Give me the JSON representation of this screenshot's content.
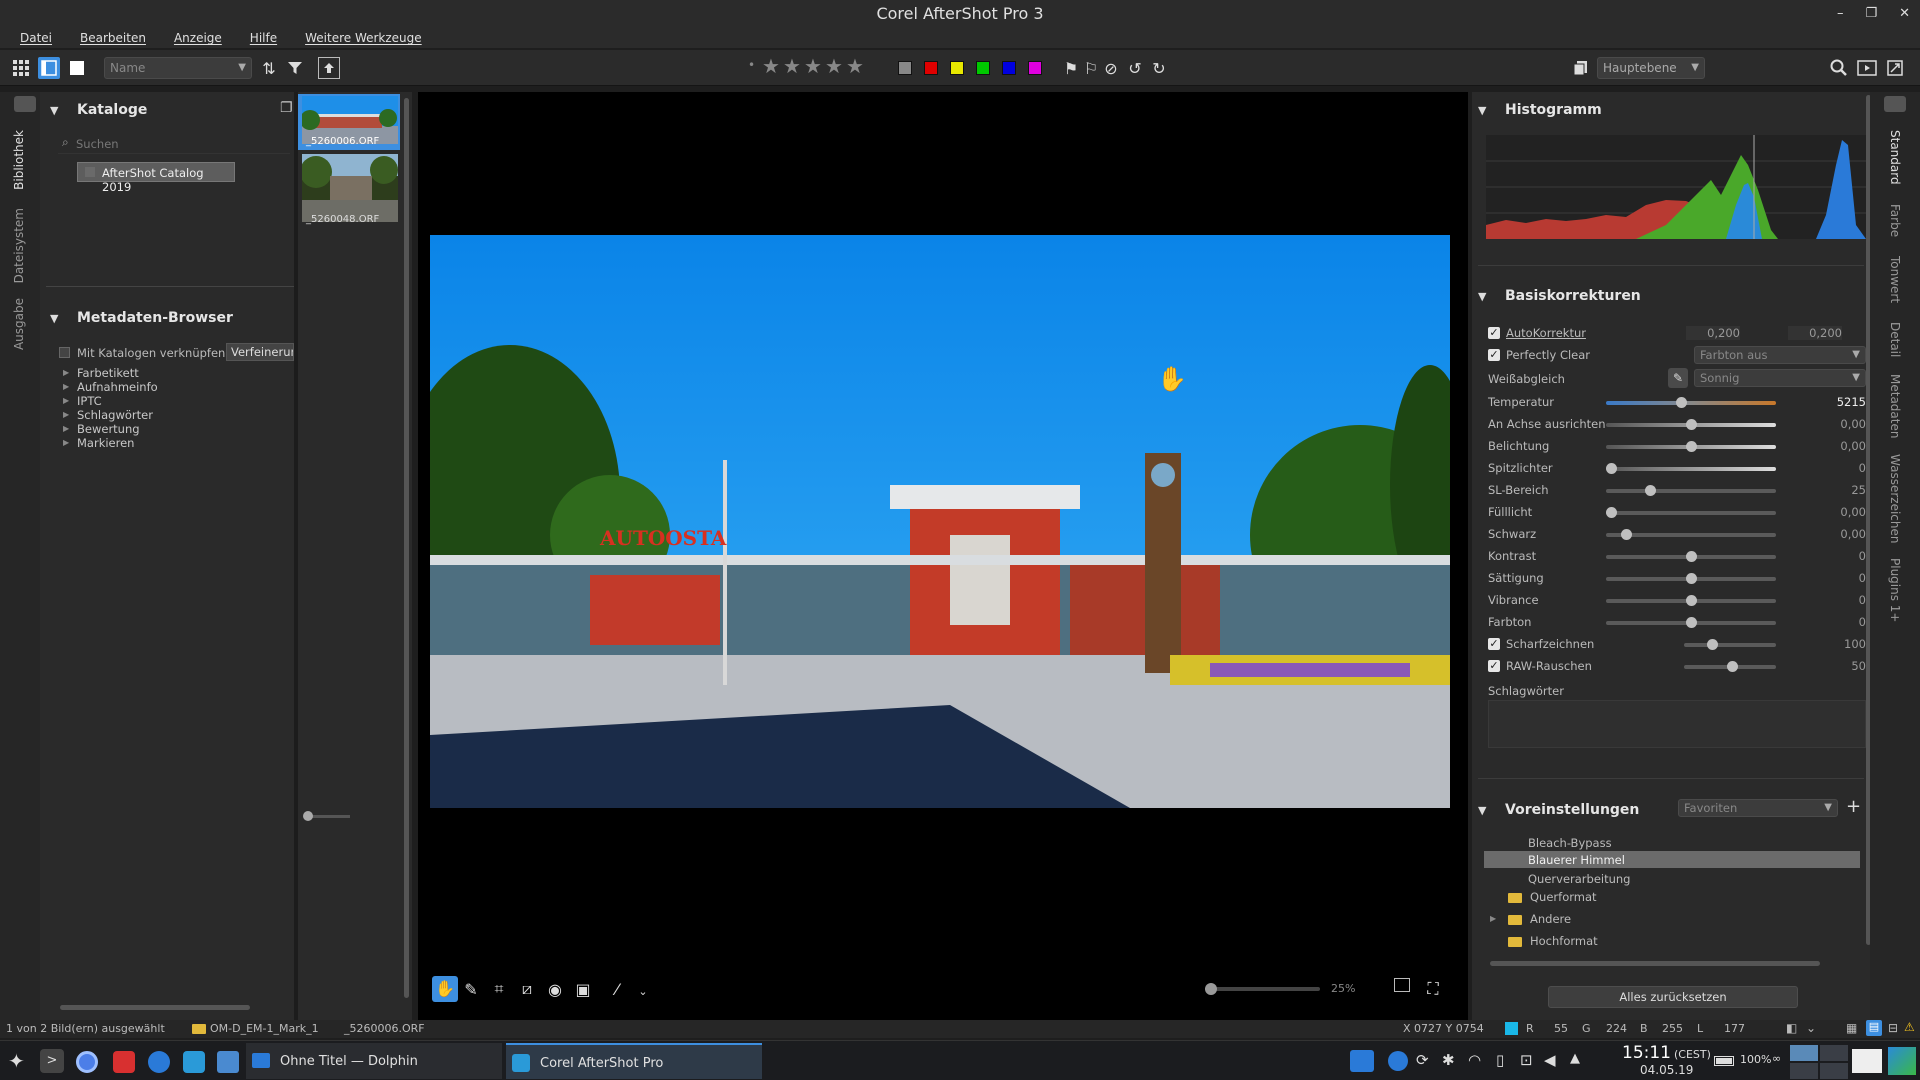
{
  "window": {
    "title": "Corel AfterShot Pro 3"
  },
  "menu": [
    "Datei",
    "Bearbeiten",
    "Anzeige",
    "Hilfe",
    "Weitere Werkzeuge"
  ],
  "toolbar": {
    "sort_select": "Name",
    "layer_select": "Hauptebene",
    "color_labels": [
      "#888888",
      "#e00000",
      "#e8e800",
      "#00c800",
      "#0000e0",
      "#e000e0"
    ]
  },
  "left_tabs": [
    "Bibliothek",
    "Dateisystem",
    "Ausgabe"
  ],
  "catalogs": {
    "title": "Kataloge",
    "search_placeholder": "Suchen",
    "items": [
      "AfterShot Catalog 2019"
    ]
  },
  "metadata_browser": {
    "title": "Metadaten-Browser",
    "link_catalogs": "Mit Katalogen verknüpfen",
    "refine_button": "Verfeinerun",
    "items": [
      "Farbetikett",
      "Aufnahmeinfo",
      "IPTC",
      "Schlagwörter",
      "Bewertung",
      "Markieren"
    ]
  },
  "filmstrip": {
    "items": [
      {
        "label": "_5260006.ORF",
        "selected": true
      },
      {
        "label": "_5260048.ORF",
        "selected": false
      }
    ]
  },
  "viewer": {
    "zoom": "25%"
  },
  "histogram": {
    "title": "Histogramm"
  },
  "basic": {
    "title": "Basiskorrekturen",
    "autocorrect": {
      "label": "AutoKorrektur",
      "v1": "0,200",
      "v2": "0,200"
    },
    "perfectly_clear": {
      "label": "Perfectly Clear",
      "select": "Farbton aus"
    },
    "white_balance": {
      "label": "Weißabgleich",
      "select": "Sonnig"
    },
    "sliders": [
      {
        "label": "Temperatur",
        "value": "5215",
        "pos": 0.44
      },
      {
        "label": "An Achse ausrichten",
        "value": "0,00",
        "pos": 0.5
      },
      {
        "label": "Belichtung",
        "value": "0,00",
        "pos": 0.5
      },
      {
        "label": "Spitzlichter",
        "value": "0",
        "pos": 0.03
      },
      {
        "label": "SL-Bereich",
        "value": "25",
        "pos": 0.26
      },
      {
        "label": "Fülllicht",
        "value": "0,00",
        "pos": 0.03
      },
      {
        "label": "Schwarz",
        "value": "0,00",
        "pos": 0.12
      },
      {
        "label": "Kontrast",
        "value": "0",
        "pos": 0.5
      },
      {
        "label": "Sättigung",
        "value": "0",
        "pos": 0.5
      },
      {
        "label": "Vibrance",
        "value": "0",
        "pos": 0.5
      },
      {
        "label": "Farbton",
        "value": "0",
        "pos": 0.5
      }
    ],
    "sharpen": {
      "label": "Scharfzeichnen",
      "value": "100",
      "pos": 0.3
    },
    "raw_noise": {
      "label": "RAW-Rauschen",
      "value": "50",
      "pos": 0.52
    },
    "keywords": "Schlagwörter"
  },
  "presets": {
    "title": "Voreinstellungen",
    "select": "Favoriten",
    "items": [
      "Bleach-Bypass",
      "Blauerer Himmel",
      "Querverarbeitung"
    ],
    "folders": [
      "Querformat",
      "Andere",
      "Hochformat"
    ],
    "reset": "Alles zurücksetzen"
  },
  "right_tabs": [
    "Standard",
    "Farbe",
    "Tonwert",
    "Detail",
    "Metadaten",
    "Wasserzeichen",
    "Plugins 1+"
  ],
  "status": {
    "selection": "1 von 2 Bild(ern) ausgewählt",
    "folder": "OM-D_EM-1_Mark_1",
    "file": "_5260006.ORF",
    "coords": "X 0727  Y 0754",
    "r_label": "R",
    "r": "55",
    "g_label": "G",
    "g": "224",
    "b_label": "B",
    "b": "255",
    "l_label": "L",
    "l": "177"
  },
  "taskbar": {
    "tasks": [
      "Ohne Titel — Dolphin",
      "Corel AfterShot Pro"
    ],
    "battery": "100%",
    "time": "15:11",
    "tz": "(CEST)",
    "date": "04.05.19"
  }
}
